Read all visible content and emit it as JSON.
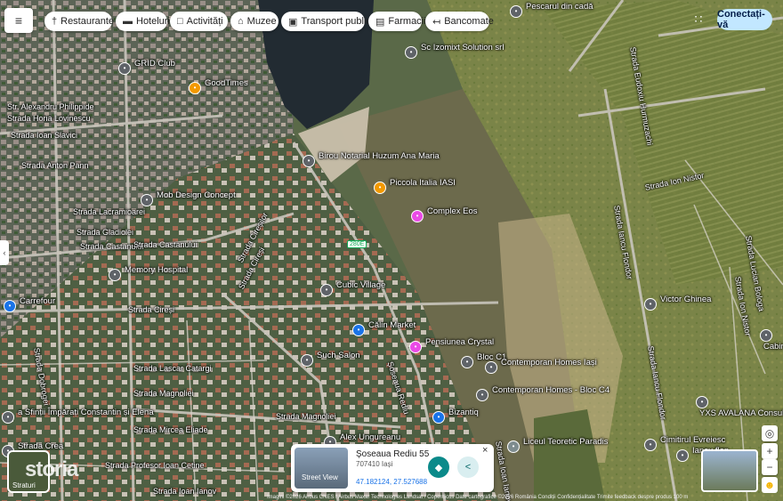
{
  "top_bar": {
    "chips": [
      {
        "icon": "restaurant-icon",
        "glyph": "†",
        "label": "Restaurante"
      },
      {
        "icon": "hotel-icon",
        "glyph": "▬",
        "label": "Hoteluri"
      },
      {
        "icon": "camera-icon",
        "glyph": "□",
        "label": "Activități"
      },
      {
        "icon": "museum-icon",
        "glyph": "⌂",
        "label": "Muzee"
      },
      {
        "icon": "transit-icon",
        "glyph": "▣",
        "label": "Transport public"
      },
      {
        "icon": "pharmacy-icon",
        "glyph": "▤",
        "label": "Farmacii"
      },
      {
        "icon": "atm-icon",
        "glyph": "↤",
        "label": "Bancomate"
      }
    ],
    "apps_glyph": "∷",
    "sign_in": "Conectați-vă",
    "menu_glyph": "≡"
  },
  "streets": [
    "Str. Alexandru Philippide",
    "Strada Horia Lovinescu",
    "Strada Ioan Slavici",
    "Strada Anton Pann",
    "Strada Lacramioarei",
    "Strada Gladiolei",
    "Strada Castanului",
    "Strada Castanului",
    "Strada Cireși",
    "Strada Cireși",
    "Strada Lascar Catargi",
    "Strada Magnoliei",
    "Strada Magnoliei",
    "Strada Mircea Eliade",
    "Strada Profesor Ioan Cetine",
    "Strada Ioan Ianov",
    "Strada Ion Nistor",
    "Strada Eudoxiu Hurmuzachi",
    "Strada Iancu Flondor",
    "Strada Iancu Flondor",
    "Strada Lucian Bologa",
    "Strada Ion Nistor",
    "Strada Dobrogei",
    "Strada Cireșilor",
    "Șoseaua Rediu",
    "Strada Ioan Ianov"
  ],
  "pois": [
    {
      "name": "GRID Club",
      "icon": "pin-icon"
    },
    {
      "name": "GoodTimes",
      "icon": "restaurant-icon"
    },
    {
      "name": "Sc Izomixt Solution srl",
      "icon": "pin-icon"
    },
    {
      "name": "Pescarul din cadă",
      "icon": "pin-icon"
    },
    {
      "name": "Birou Notarial Huzum Ana Maria",
      "icon": "pin-icon"
    },
    {
      "name": "Piccola Italia IASI",
      "icon": "restaurant-icon"
    },
    {
      "name": "Complex Eos",
      "icon": "hotel-icon"
    },
    {
      "name": "Mob Design Concept",
      "icon": "pin-icon"
    },
    {
      "name": "Memory Hospital",
      "icon": "pin-icon"
    },
    {
      "name": "Cubic Village",
      "icon": "pin-icon"
    },
    {
      "name": "Călin Market",
      "icon": "shop-icon"
    },
    {
      "name": "Pensiunea Crystal",
      "icon": "hotel-icon"
    },
    {
      "name": "Bloc C1",
      "icon": "pin-icon"
    },
    {
      "name": "Contemporan Homes Iași",
      "icon": "pin-icon"
    },
    {
      "name": "Contemporan Homes - Bloc C4",
      "icon": "pin-icon"
    },
    {
      "name": "Bizantiq",
      "icon": "shop-icon"
    },
    {
      "name": "Such Salon",
      "icon": "pin-icon"
    },
    {
      "name": "Alex Ungureanu",
      "icon": "pin-icon"
    },
    {
      "name": "Liceul Teoretic Paradis",
      "icon": "school-icon"
    },
    {
      "name": "Victor Ghinea",
      "icon": "pin-icon"
    },
    {
      "name": "Cabinet Avocatura Gabriela Gheorghiu",
      "icon": "pin-icon"
    },
    {
      "name": "YXS AVALANA Consultanță fonduri",
      "icon": "pin-icon"
    },
    {
      "name": "Cimitirul Evreiesc",
      "icon": "pin-icon"
    },
    {
      "name": "Iancu flon",
      "icon": "pin-icon"
    },
    {
      "name": "Carrefour",
      "icon": "shop-icon"
    },
    {
      "name": "a Sfinții Împărați Constantin și Elena",
      "icon": "church-icon"
    },
    {
      "name": "Strada Crea",
      "icon": "pin-icon"
    }
  ],
  "road_shield": "280E",
  "layers_label": "Straturi",
  "watermark": "storia",
  "place_card": {
    "title": "Șoseaua Rediu 55",
    "subtitle": "707410 Iași",
    "coords": "47.182124, 27.527688",
    "street_view": "Street View",
    "close": "×"
  },
  "controls": {
    "zoom_in": "+",
    "zoom_out": "−",
    "locate": "◎",
    "pegman": "☻",
    "collapse": "‹"
  },
  "footer": "Imagini ©2026 Airbus CNES / Airbus Maxar Technologies Landsat / Copernicus Date cartografice ©2026  România  Condiții  Confidențialitate  Trimite feedback despre produs  100 m",
  "colors": {
    "restaurant": "#f29900",
    "pin": "#5f6368",
    "hotel": "#ea4ae6",
    "shop": "#1a73e8",
    "school": "#7e8c8f"
  }
}
